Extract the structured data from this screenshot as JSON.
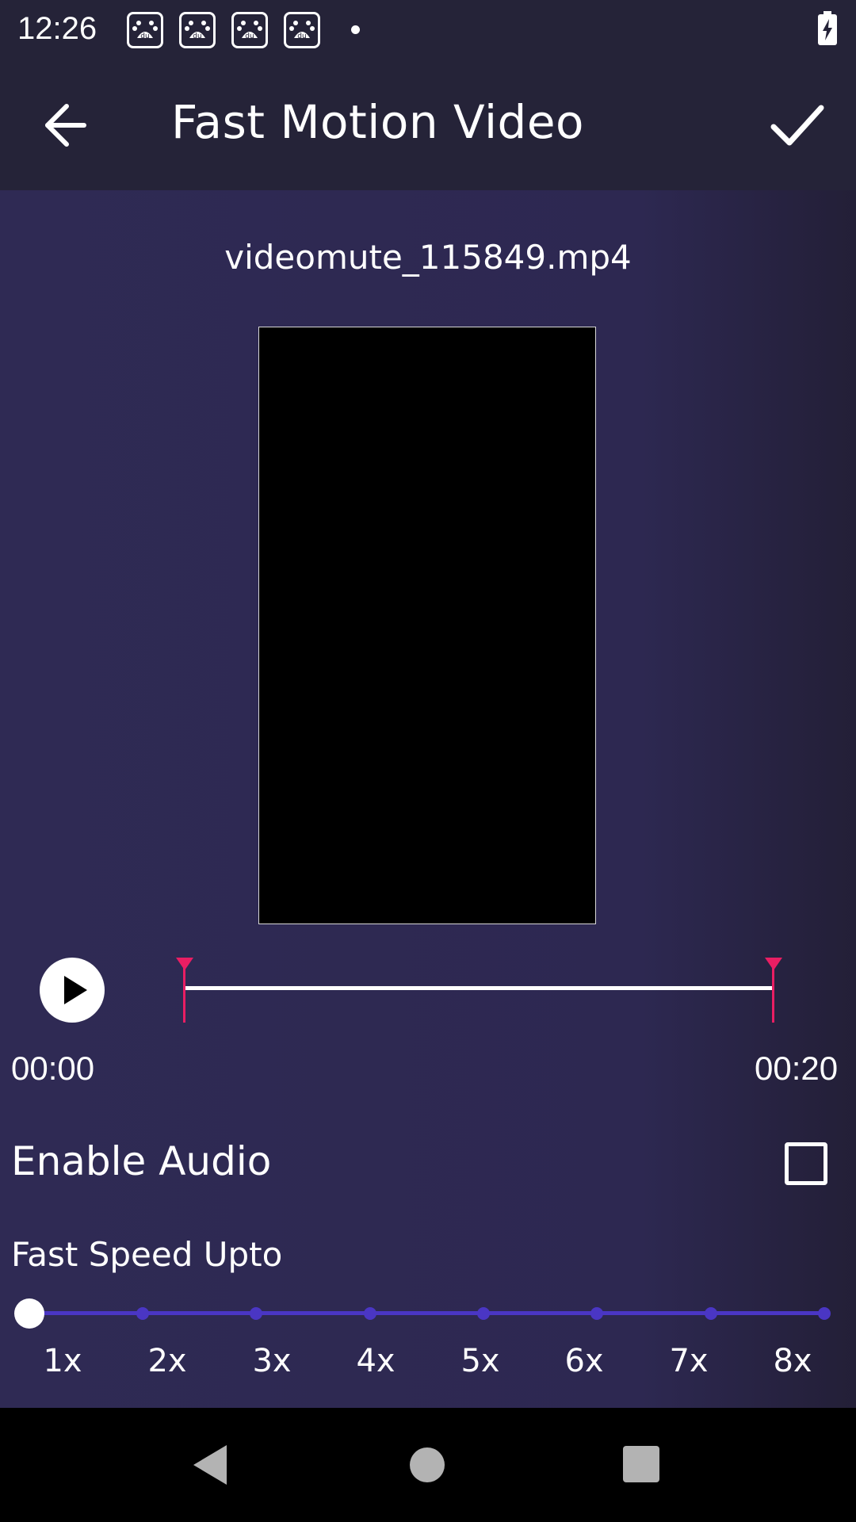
{
  "status_bar": {
    "time": "12:26",
    "notification_icons": [
      "baidu-icon",
      "baidu-icon",
      "baidu-icon",
      "baidu-icon"
    ],
    "notification_icon_text": "du",
    "battery_state": "charging"
  },
  "app_bar": {
    "title": "Fast Motion Video",
    "back_icon": "arrow-left-icon",
    "confirm_icon": "check-icon"
  },
  "video": {
    "file_name": "videomute_115849.mp4"
  },
  "trim": {
    "start_time": "00:00",
    "end_time": "00:20",
    "play_icon": "play-icon"
  },
  "audio": {
    "label": "Enable Audio",
    "checked": false
  },
  "speed": {
    "label": "Fast Speed Upto",
    "options": [
      "1x",
      "2x",
      "3x",
      "4x",
      "5x",
      "6x",
      "7x",
      "8x"
    ],
    "selected": "1x"
  },
  "colors": {
    "background": "#2d2851",
    "app_bar": "#252338",
    "accent_marker": "#e91e63",
    "slider": "#4a36c4"
  },
  "nav_bar": {
    "icons": [
      "nav-back-icon",
      "nav-home-icon",
      "nav-recents-icon"
    ]
  }
}
